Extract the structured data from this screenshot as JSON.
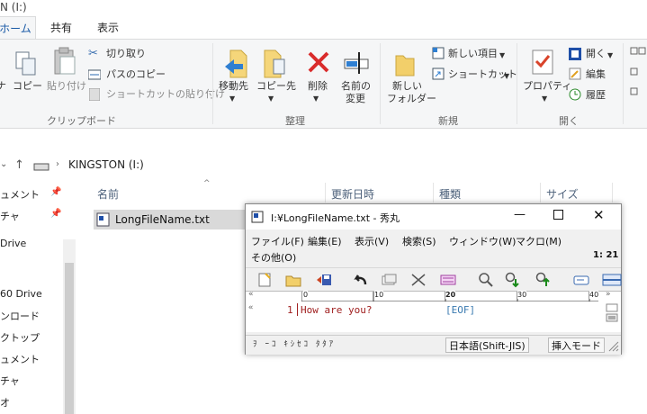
{
  "window": {
    "title_fragment": "N (I:)"
  },
  "tabs": [
    {
      "label": "ホーム"
    },
    {
      "label": "共有"
    },
    {
      "label": "表示"
    }
  ],
  "ribbon": {
    "copy": "コピー",
    "paste": "貼り付け",
    "cut": "切り取り",
    "copy_path": "パスのコピー",
    "paste_shortcut": "ショートカットの貼り付け",
    "clipboard_group": "クリップボード",
    "left_partial": "ナ",
    "move_to": "移動先",
    "copy_to": "コピー先",
    "delete": "削除",
    "rename_1": "名前の",
    "rename_2": "変更",
    "organize_group": "整理",
    "new_folder_1": "新しい",
    "new_folder_2": "フォルダー",
    "new_item": "新しい項目",
    "shortcut": "ショートカット",
    "new_group": "新規",
    "properties": "プロパティ",
    "open": "開く",
    "edit": "編集",
    "history": "履歴",
    "open_group": "開く"
  },
  "address": {
    "path": "KINGSTON (I:)"
  },
  "sidebar": {
    "items": [
      "ュメント",
      "チャ",
      "Drive",
      "60 Drive",
      "ンロード",
      "クトップ",
      "ュメント",
      "チャ",
      "オ"
    ]
  },
  "list": {
    "headers": {
      "name": "名前",
      "modified": "更新日時",
      "type": "種類",
      "size": "サイズ"
    },
    "files": [
      {
        "name": "LongFileName.txt"
      }
    ]
  },
  "hidemaru": {
    "title": "I:¥LongFileName.txt - 秀丸",
    "menu": [
      "ファイル(F)",
      "編集(E)",
      "表示(V)",
      "検索(S)",
      "ウィンドウ(W)",
      "マクロ(M)",
      "その他(O)"
    ],
    "position": "1: 21",
    "ruler": {
      "marks": [
        "0",
        "10",
        "20",
        "30",
        "40"
      ]
    },
    "line_number": "1",
    "text": "How are you?",
    "eof": "[EOF]",
    "status": {
      "left": "ｦ　ｰ ｺ　ｷ ｼ ｾ ｺ　ﾀ ﾀ ｱ",
      "encoding": "日本語(Shift-JIS)",
      "mode": "挿入モード"
    }
  }
}
